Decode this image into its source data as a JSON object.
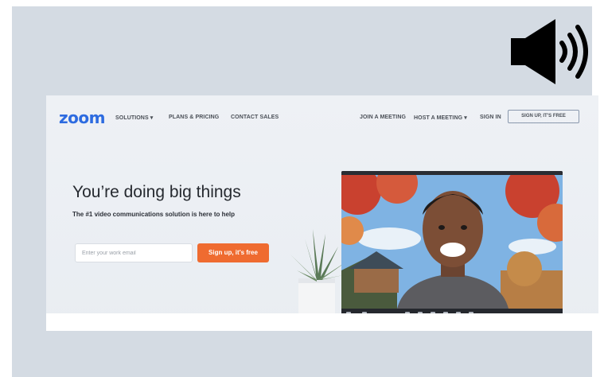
{
  "nav": {
    "logo": "zoom",
    "solutions": "SOLUTIONS ▾",
    "plans": "PLANS & PRICING",
    "contact": "CONTACT SALES",
    "join": "JOIN A MEETING",
    "host": "HOST A MEETING ▾",
    "signin": "SIGN IN",
    "signup_free": "SIGN UP, IT'S FREE"
  },
  "hero": {
    "headline": "You’re doing big things",
    "subhead": "The #1 video communications solution is here to help",
    "email_placeholder": "Enter your work email",
    "signup_button": "Sign up, it's free"
  },
  "colors": {
    "accent": "#2d6be0",
    "cta": "#ef6b30",
    "frame": "#d4dbe3"
  },
  "icons": [
    "speaker-icon",
    "plant-image",
    "video-call-image"
  ]
}
